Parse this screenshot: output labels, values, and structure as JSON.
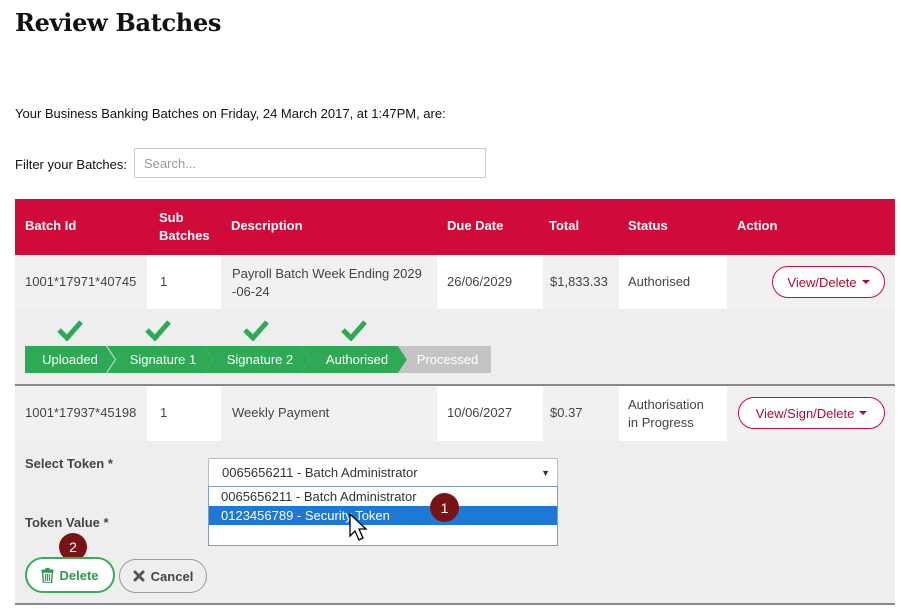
{
  "page": {
    "title": "Review Batches",
    "intro": "Your Business Banking Batches on Friday, 24 March 2017, at 1:47PM, are:"
  },
  "filter": {
    "label": "Filter your Batches:",
    "placeholder": "Search..."
  },
  "table": {
    "headers": {
      "batch_id": "Batch Id",
      "sub_batches_1": "Sub",
      "sub_batches_2": "Batches",
      "description": "Description",
      "due_date": "Due Date",
      "total": "Total",
      "status": "Status",
      "action": "Action"
    },
    "rows": [
      {
        "batch_id": "1001*17971*40745",
        "sub_batches": "1",
        "description_1": "Payroll Batch Week Ending 2029",
        "description_2": "-06-24",
        "due_date": "26/06/2029",
        "total": "$1,833.33",
        "status_1": "Authorised",
        "status_2": "",
        "action": "View/Delete"
      },
      {
        "batch_id": "1001*17937*45198",
        "sub_batches": "1",
        "description_1": "Weekly Payment",
        "description_2": "",
        "due_date": "10/06/2027",
        "total": "$0.37",
        "status_1": "Authorisation",
        "status_2": "in Progress",
        "action": "View/Sign/Delete"
      }
    ]
  },
  "progress": {
    "steps": [
      {
        "label": "Uploaded",
        "done": true
      },
      {
        "label": "Signature 1",
        "done": true
      },
      {
        "label": "Signature 2",
        "done": true
      },
      {
        "label": "Authorised",
        "done": true
      },
      {
        "label": "Processed",
        "done": false
      }
    ],
    "colors": {
      "done": "#2eaa57",
      "pending": "#c4c4c4",
      "check": "#2eaa57"
    }
  },
  "token_form": {
    "select_label": "Select Token *",
    "selected_value": "0065656211 - Batch Administrator",
    "options": [
      "0065656211 - Batch Administrator",
      "0123456789 - Security Token"
    ],
    "token_value_label": "Token Value *",
    "delete_label": "Delete",
    "cancel_label": "Cancel"
  },
  "markers": {
    "one": "1",
    "two": "2"
  },
  "colors": {
    "brand": "#d00b3a",
    "marker": "#7a1414",
    "highlight": "#1e78d6"
  }
}
